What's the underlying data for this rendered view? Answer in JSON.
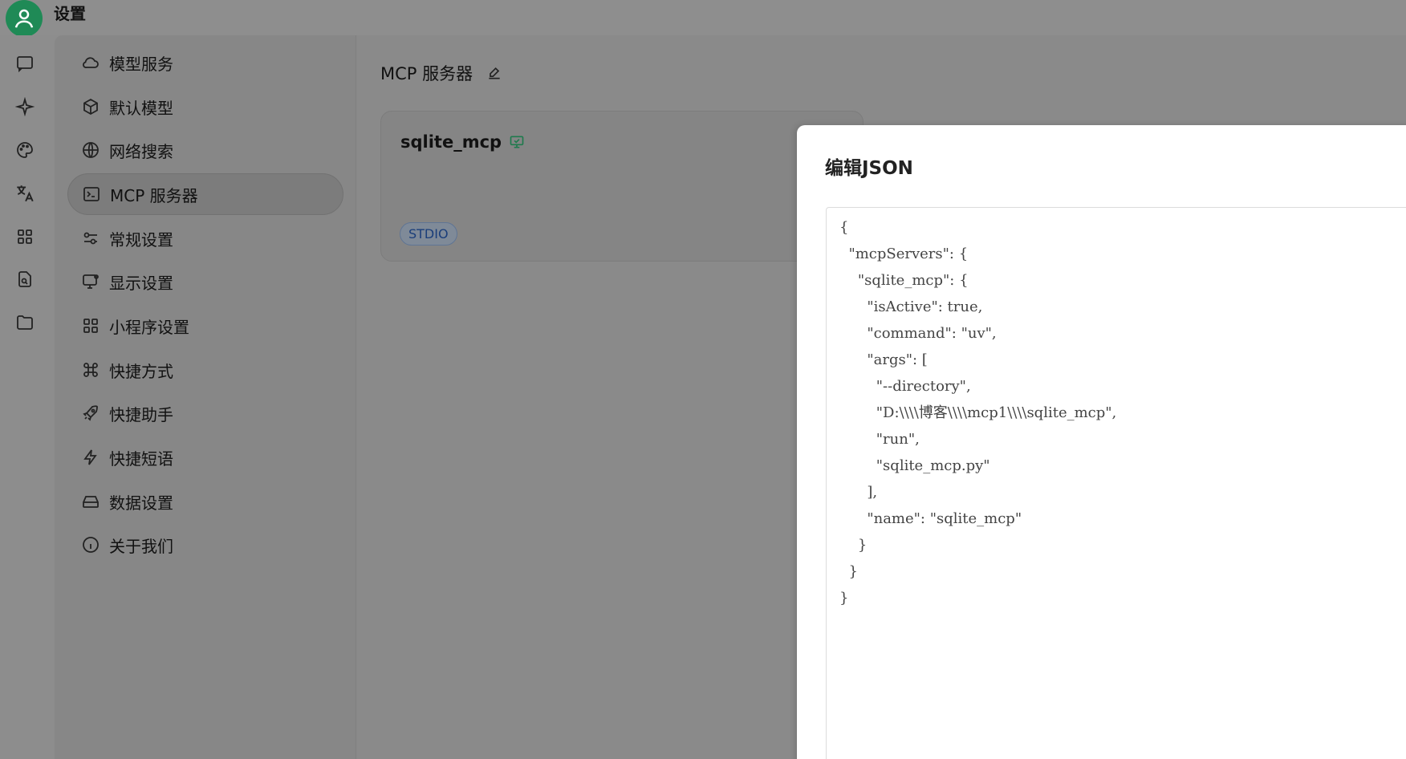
{
  "app": {
    "title": "设置"
  },
  "rail": {
    "icons": [
      "chat-icon",
      "sparkle-icon",
      "palette-icon",
      "translate-icon",
      "apps-icon",
      "document-search-icon",
      "folder-icon"
    ]
  },
  "settings_nav": {
    "items": [
      {
        "label": "模型服务",
        "icon": "cloud-icon"
      },
      {
        "label": "默认模型",
        "icon": "cube-icon"
      },
      {
        "label": "网络搜索",
        "icon": "globe-icon"
      },
      {
        "label": "MCP 服务器",
        "icon": "terminal-icon",
        "active": true
      },
      {
        "label": "常规设置",
        "icon": "sliders-icon"
      },
      {
        "label": "显示设置",
        "icon": "monitor-gear-icon"
      },
      {
        "label": "小程序设置",
        "icon": "apps-icon"
      },
      {
        "label": "快捷方式",
        "icon": "command-icon"
      },
      {
        "label": "快捷助手",
        "icon": "rocket-icon"
      },
      {
        "label": "快捷短语",
        "icon": "lightning-icon"
      },
      {
        "label": "数据设置",
        "icon": "hard-drive-icon"
      },
      {
        "label": "关于我们",
        "icon": "info-icon"
      }
    ]
  },
  "main": {
    "heading": "MCP 服务器",
    "server": {
      "name": "sqlite_mcp",
      "tag": "STDIO"
    }
  },
  "modal": {
    "title": "编辑JSON",
    "json_text": "{\n  \"mcpServers\": {\n    \"sqlite_mcp\": {\n      \"isActive\": true,\n      \"command\": \"uv\",\n      \"args\": [\n        \"--directory\",\n        \"D:\\\\\\\\博客\\\\\\\\mcp1\\\\\\\\sqlite_mcp\",\n        \"run\",\n        \"sqlite_mcp.py\"\n      ],\n      \"name\": \"sqlite_mcp\"\n    }\n  }\n}"
  },
  "colors": {
    "accent_green": "#1f8a56",
    "tag_blue": "#1a3e7a"
  }
}
